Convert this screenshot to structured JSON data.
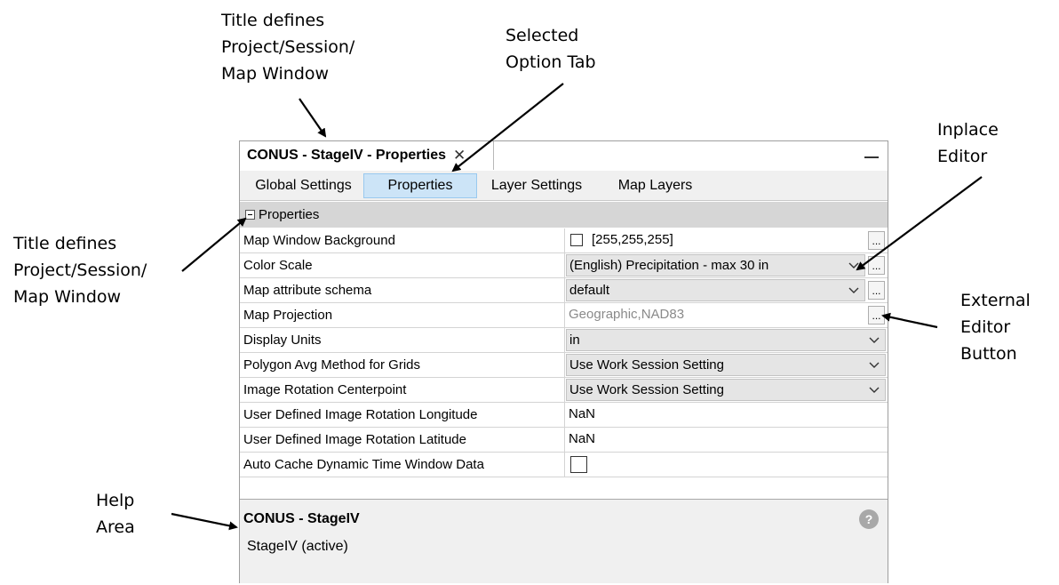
{
  "annotations": {
    "title_top": [
      "Title defines",
      "Project/Session/",
      "Map Window"
    ],
    "selected_tab": [
      "Selected",
      "Option Tab"
    ],
    "inplace_editor": [
      "Inplace",
      "Editor"
    ],
    "title_left": [
      "Title defines",
      "Project/Session/",
      "Map Window"
    ],
    "external_editor": [
      "External",
      "Editor",
      "Button"
    ],
    "help_area": [
      "Help",
      "Area"
    ]
  },
  "window": {
    "title": "CONUS - StageIV - Properties",
    "close_glyph": "✕"
  },
  "tabs": [
    {
      "label": "Global Settings",
      "selected": false
    },
    {
      "label": "Properties",
      "selected": true
    },
    {
      "label": "Layer Settings",
      "selected": false
    },
    {
      "label": "Map Layers",
      "selected": false
    }
  ],
  "group": {
    "label": "Properties",
    "expanded": true
  },
  "properties": [
    {
      "name": "Map Window Background",
      "value": "[255,255,255]",
      "editor": "color",
      "color": "#ffffff"
    },
    {
      "name": "Color Scale",
      "value": "(English) Precipitation - max 30 in",
      "editor": "combo"
    },
    {
      "name": "Map attribute schema",
      "value": "default",
      "editor": "combo"
    },
    {
      "name": "Map Projection",
      "value": "Geographic,NAD83",
      "editor": "readonly"
    },
    {
      "name": "Display Units",
      "value": "in",
      "editor": "combo"
    },
    {
      "name": "Polygon Avg Method for Grids",
      "value": "Use Work Session Setting",
      "editor": "combo"
    },
    {
      "name": "Image Rotation Centerpoint",
      "value": "Use Work Session Setting",
      "editor": "combo"
    },
    {
      "name": "User Defined Image Rotation Longitude",
      "value": "NaN",
      "editor": "text"
    },
    {
      "name": "User Defined Image Rotation Latitude",
      "value": "NaN",
      "editor": "text"
    },
    {
      "name": "Auto Cache Dynamic Time Window Data",
      "value": "",
      "editor": "checkbox",
      "checked": false
    }
  ],
  "ellipsis_label": "...",
  "help": {
    "title": "CONUS - StageIV",
    "description": "StageIV (active)",
    "icon_glyph": "?"
  },
  "colors": {
    "selected_tab": "#cce4f7",
    "group_header": "#d6d6d6",
    "help_background": "#f0f0f0"
  }
}
